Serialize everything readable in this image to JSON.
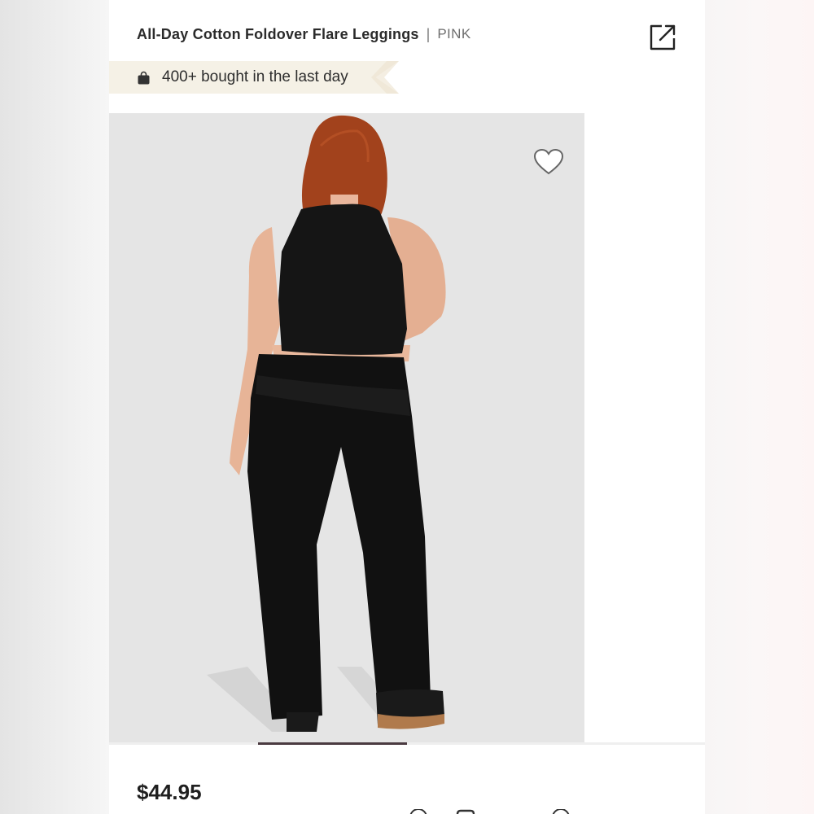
{
  "product": {
    "title": "All-Day Cotton Foldover Flare Leggings",
    "separator": "|",
    "brand": "PINK",
    "price": "$44.95"
  },
  "social_proof": {
    "text": "400+ bought in the last day",
    "icon": "shopping-bag-icon"
  },
  "icons": {
    "share": "share-icon",
    "favorite": "heart-icon"
  },
  "gallery": {
    "image_alt": "Model wearing black foldover flare leggings and black cropped tank, back view",
    "active_index": 1,
    "total": 4
  },
  "colors": {
    "banner_bg": "#f5f1e6",
    "indicator": "#4a3a40",
    "image_bg": "#e6e6e6"
  }
}
